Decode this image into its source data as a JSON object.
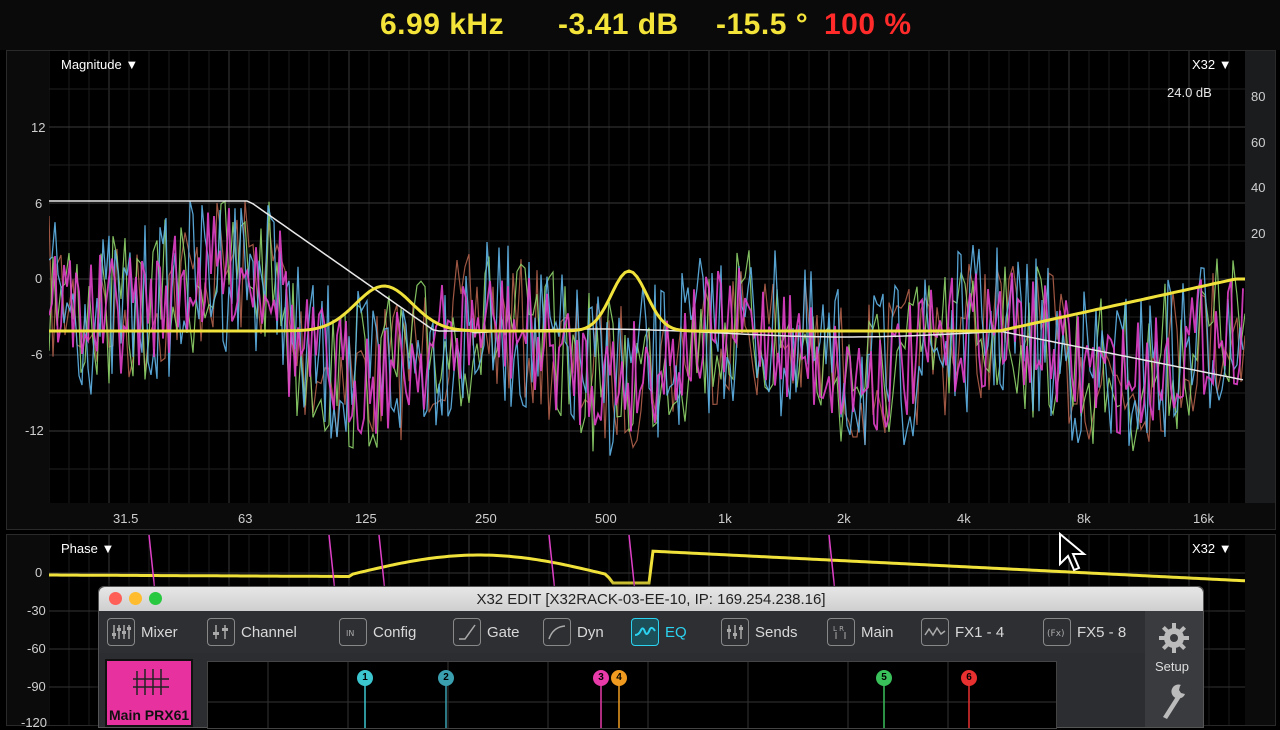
{
  "readout": {
    "frequency": "6.99 kHz",
    "gain": "-3.41 dB",
    "phase": "-15.5 °",
    "percent": "100 %"
  },
  "magnitude_panel": {
    "mode_label": "Magnitude",
    "source_label": "X32",
    "range_label": "24.0 dB",
    "y_ticks": [
      "12",
      "6",
      "0",
      "-6",
      "-12"
    ],
    "right_ticks": [
      "80",
      "60",
      "40",
      "20"
    ],
    "x_ticks": [
      "31.5",
      "63",
      "125",
      "250",
      "500",
      "1k",
      "2k",
      "4k",
      "8k",
      "16k"
    ]
  },
  "phase_panel": {
    "mode_label": "Phase",
    "source_label": "X32",
    "y_ticks": [
      "0",
      "-30",
      "-60",
      "-90",
      "-120"
    ]
  },
  "x32_window": {
    "title": "X32 EDIT [X32RACK-03-EE-10, IP: 169.254.238.16]",
    "tabs": [
      {
        "label": "Mixer",
        "icon": "mixer-icon"
      },
      {
        "label": "Channel",
        "icon": "channel-icon"
      },
      {
        "label": "Config",
        "icon": "config-icon"
      },
      {
        "label": "Gate",
        "icon": "gate-icon"
      },
      {
        "label": "Dyn",
        "icon": "dyn-icon"
      },
      {
        "label": "EQ",
        "icon": "eq-icon"
      },
      {
        "label": "Sends",
        "icon": "sends-icon"
      },
      {
        "label": "Main",
        "icon": "main-icon"
      },
      {
        "label": "FX1 - 4",
        "icon": "fx-icon"
      },
      {
        "label": "FX5 - 8",
        "icon": "fx2-icon"
      }
    ],
    "active_tab": "EQ",
    "setup_label": "Setup",
    "channel_name": "Main PRX61",
    "eq_bands": [
      "1",
      "2",
      "3",
      "4",
      "5",
      "6"
    ]
  },
  "colors": {
    "readout_value": "#f4e43a",
    "readout_alert": "#ff2a2a",
    "trace_magenta": "#e040c8",
    "trace_blue": "#5fb4e8",
    "trace_green": "#8fd46a",
    "trace_brown": "#b0604a",
    "curve_yellow": "#f0e23a",
    "channel_color": "#e6319e",
    "active_tab": "#2bd3f0",
    "band_1": "#3cc6d0",
    "band_2": "#3aa0b0",
    "band_3": "#e83aa8",
    "band_4": "#f09a20",
    "band_5": "#3ac05a",
    "band_6": "#e83030"
  }
}
